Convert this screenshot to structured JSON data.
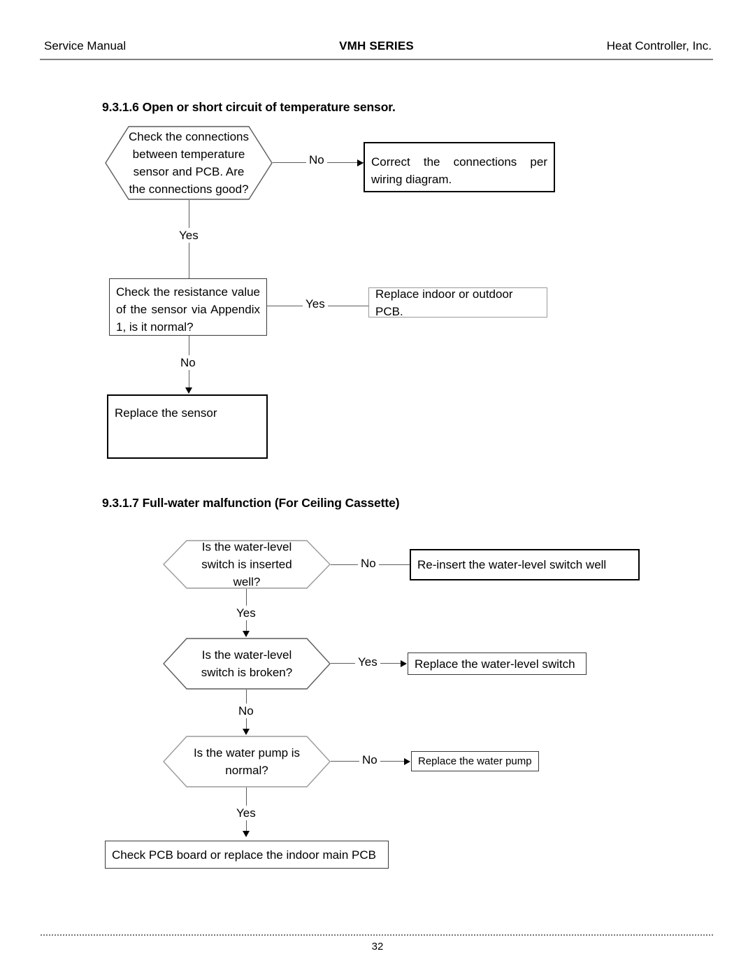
{
  "header": {
    "left": "Service Manual",
    "center": "VMH SERIES",
    "right": "Heat Controller, Inc."
  },
  "footer": {
    "page_number": "32"
  },
  "sections": [
    {
      "heading": "9.3.1.6 Open or short circuit of temperature sensor.",
      "flowchart": {
        "nodes": {
          "decision_connections": "Check the connections between temperature sensor and PCB. Are the connections good?",
          "action_correct_wiring": "Correct the connections per wiring diagram.",
          "decision_resistance": "Check the resistance value of the sensor via Appendix 1, is it normal?",
          "action_replace_pcb": "Replace indoor or outdoor PCB.",
          "action_replace_sensor": "Replace the sensor"
        },
        "edges": {
          "connections_no": "No",
          "connections_yes": "Yes",
          "resistance_yes": "Yes",
          "resistance_no": "No"
        }
      }
    },
    {
      "heading": "9.3.1.7 Full-water malfunction (For Ceiling Cassette)",
      "flowchart": {
        "nodes": {
          "decision_switch_inserted": "Is the water-level switch is inserted well?",
          "action_reinsert_switch": "Re-insert the water-level switch well",
          "decision_switch_broken": "Is the water-level switch is broken?",
          "action_replace_switch": "Replace the water-level switch",
          "decision_pump_normal": "Is the water pump is normal?",
          "action_replace_pump": "Replace the water pump",
          "action_check_pcb": "Check PCB board or replace the indoor main PCB"
        },
        "edges": {
          "inserted_no": "No",
          "inserted_yes": "Yes",
          "broken_yes": "Yes",
          "broken_no": "No",
          "pump_no": "No",
          "pump_yes": "Yes"
        }
      }
    }
  ],
  "colors": {
    "rule": "#808080",
    "connector": "#5c5c5c",
    "border_strong": "#000000",
    "border_light": "#9a9a9a"
  }
}
